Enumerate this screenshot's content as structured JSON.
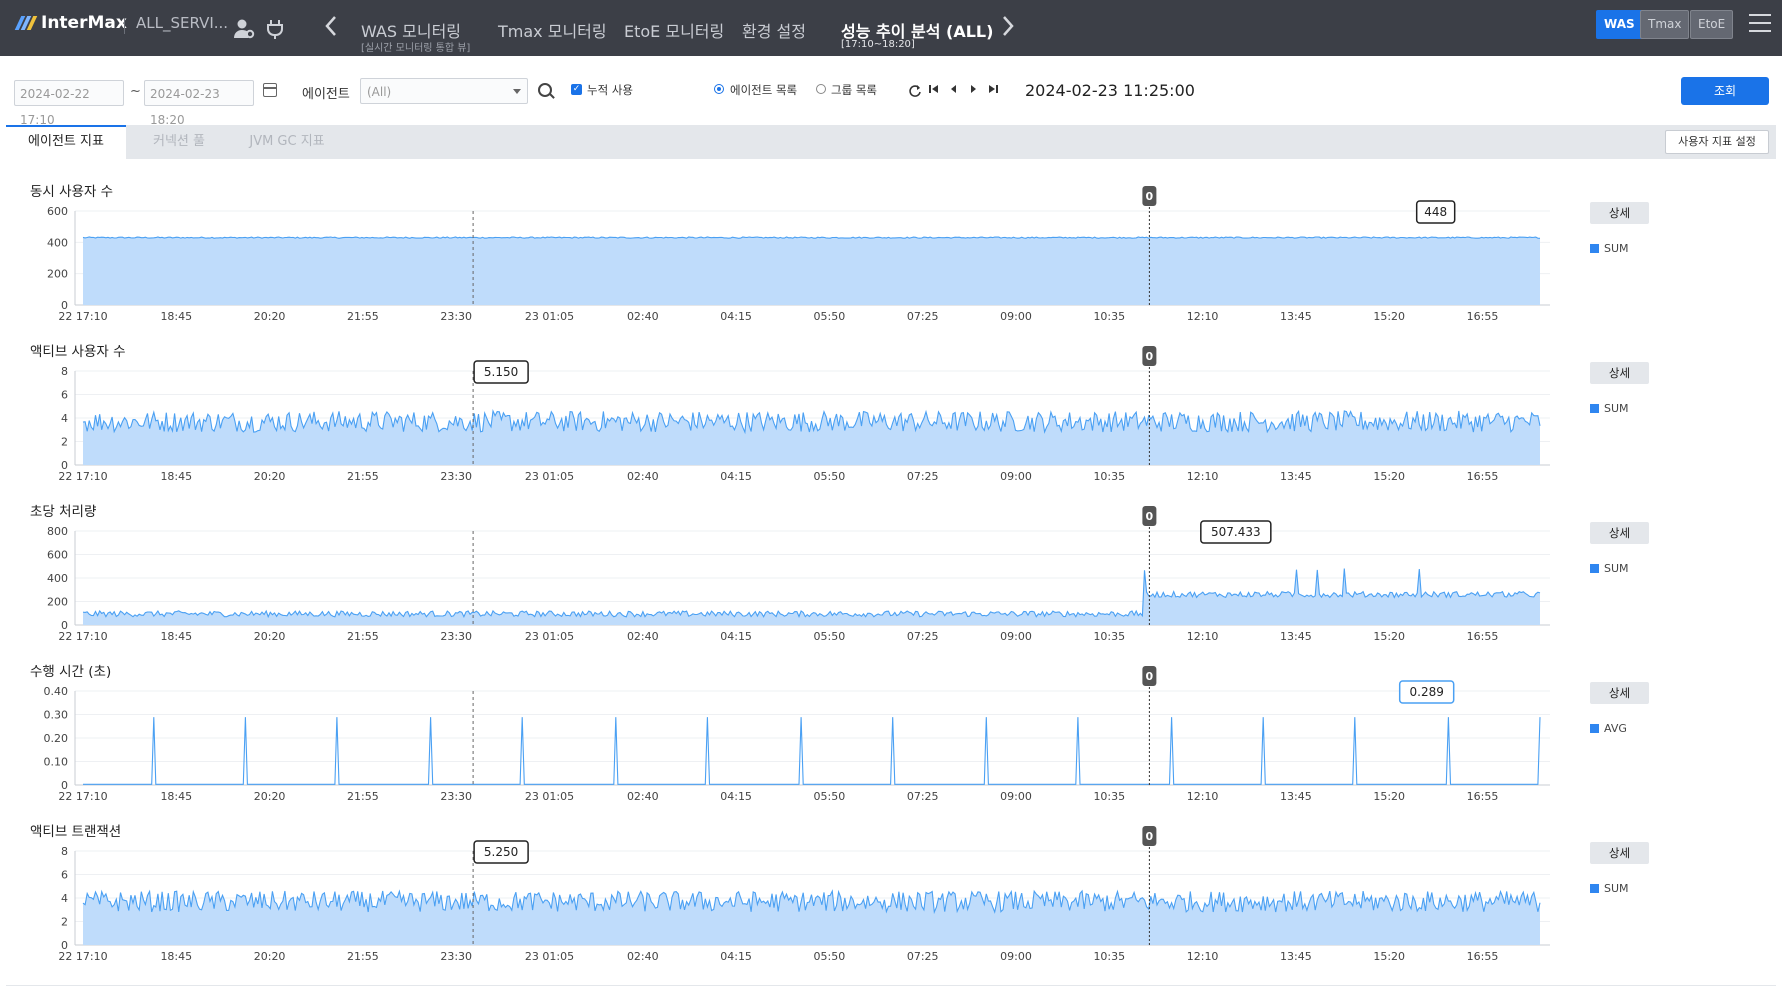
{
  "header": {
    "logo_text": "InterMax",
    "service": "ALL_SERVI...",
    "menus": [
      {
        "label": "WAS 모니터링",
        "sub": "[실시간 모니터링 통합 뷰]"
      },
      {
        "label": "Tmax 모니터링"
      },
      {
        "label": "EtoE 모니터링"
      },
      {
        "label": "환경 설정"
      },
      {
        "label": "성능 추이 분석 (ALL)",
        "sub": "[17:10~18:20]"
      }
    ],
    "product_buttons": [
      "WAS",
      "Tmax",
      "EtoE"
    ],
    "active_product": "WAS",
    "icons": [
      "user-gear-icon",
      "plug-icon",
      "chevron-left-icon",
      "chevron-right-icon",
      "hamburger-menu-icon"
    ]
  },
  "toolbar": {
    "from_date": "2024-02-22 17:10",
    "to_date": "2024-02-23 18:20",
    "tilde": "~",
    "agent_label": "에이전트",
    "agent_value": "(All)",
    "cumulative_label": "누적 사용",
    "cumulative_checked": true,
    "radio_agent_list": "에이전트 목록",
    "radio_group_list": "그룹 목록",
    "radio_selected": "에이전트 목록",
    "current_time": "2024-02-23 11:25:00",
    "query_button": "조회",
    "playback_icons": [
      "refresh-icon",
      "skip-start-icon",
      "prev-icon",
      "next-icon",
      "skip-end-icon"
    ]
  },
  "tabs": {
    "items": [
      "에이전트 지표",
      "커넥션 풀",
      "JVM GC 지표"
    ],
    "active": "에이전트 지표",
    "user_setting_button": "사용자 지표 설정"
  },
  "colors": {
    "accent": "#1a73e8",
    "series_line": "#4aa0f3",
    "series_fill": "#bfdcfb",
    "header_bg": "#3c3f47"
  },
  "chart_data": [
    {
      "type": "area",
      "title": "동시 사용자 수",
      "x_labels": [
        "22 17:10",
        "18:45",
        "20:20",
        "21:55",
        "23:30",
        "23 01:05",
        "02:40",
        "04:15",
        "05:50",
        "07:25",
        "09:00",
        "10:35",
        "12:10",
        "13:45",
        "15:20",
        "16:55"
      ],
      "y_ticks": [
        "0",
        "200",
        "400",
        "600"
      ],
      "ylim": [
        0,
        600
      ],
      "series": [
        {
          "name": "SUM",
          "level": 430,
          "noise": 4
        }
      ],
      "marker_label": "0",
      "tooltip": "448",
      "detail_button": "상세"
    },
    {
      "type": "area",
      "title": "액티브 사용자 수",
      "x_labels": [
        "22 17:10",
        "18:45",
        "20:20",
        "21:55",
        "23:30",
        "23 01:05",
        "02:40",
        "04:15",
        "05:50",
        "07:25",
        "09:00",
        "10:35",
        "12:10",
        "13:45",
        "15:20",
        "16:55"
      ],
      "y_ticks": [
        "0",
        "2",
        "4",
        "6",
        "8"
      ],
      "ylim": [
        0,
        8
      ],
      "series": [
        {
          "name": "SUM",
          "level": 3.7,
          "noise": 0.9
        }
      ],
      "marker_label": "0",
      "tooltip": "5.150",
      "detail_button": "상세"
    },
    {
      "type": "area",
      "title": "초당 처리량",
      "x_labels": [
        "22 17:10",
        "18:45",
        "20:20",
        "21:55",
        "23:30",
        "23 01:05",
        "02:40",
        "04:15",
        "05:50",
        "07:25",
        "09:00",
        "10:35",
        "12:10",
        "13:45",
        "15:20",
        "16:55"
      ],
      "y_ticks": [
        "0",
        "200",
        "400",
        "600",
        "800"
      ],
      "ylim": [
        0,
        800
      ],
      "series": [
        {
          "name": "SUM",
          "level": 95,
          "level_after_marker": 260,
          "noise": 25
        }
      ],
      "marker_label": "0",
      "tooltip": "507.433",
      "detail_button": "상세"
    },
    {
      "type": "line",
      "title": "수행 시간 (초)",
      "x_labels": [
        "22 17:10",
        "18:45",
        "20:20",
        "21:55",
        "23:30",
        "23 01:05",
        "02:40",
        "04:15",
        "05:50",
        "07:25",
        "09:00",
        "10:35",
        "12:10",
        "13:45",
        "15:20",
        "16:55"
      ],
      "y_ticks": [
        "0",
        "0.10",
        "0.20",
        "0.30",
        "0.40"
      ],
      "ylim": [
        0,
        0.4
      ],
      "series": [
        {
          "name": "AVG",
          "level": 0.003,
          "spike_value": 0.289
        }
      ],
      "marker_label": "0",
      "tooltip": "0.289",
      "detail_button": "상세"
    },
    {
      "type": "area",
      "title": "액티브 트랜잭션",
      "x_labels": [
        "22 17:10",
        "18:45",
        "20:20",
        "21:55",
        "23:30",
        "23 01:05",
        "02:40",
        "04:15",
        "05:50",
        "07:25",
        "09:00",
        "10:35",
        "12:10",
        "13:45",
        "15:20",
        "16:55"
      ],
      "y_ticks": [
        "0",
        "2",
        "4",
        "6",
        "8"
      ],
      "ylim": [
        0,
        8
      ],
      "series": [
        {
          "name": "SUM",
          "level": 3.7,
          "noise": 0.9
        }
      ],
      "marker_label": "0",
      "tooltip": "5.250",
      "detail_button": "상세"
    }
  ]
}
